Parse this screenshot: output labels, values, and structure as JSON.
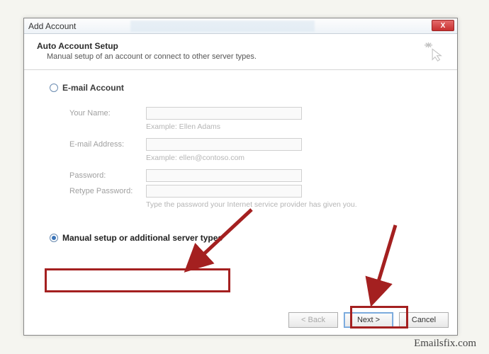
{
  "window": {
    "title": "Add Account",
    "close_label": "X"
  },
  "header": {
    "title": "Auto Account Setup",
    "subtitle": "Manual setup of an account or connect to other server types."
  },
  "options": {
    "email_account": "E-mail Account",
    "manual_setup": "Manual setup or additional server types"
  },
  "form": {
    "your_name_label": "Your Name:",
    "your_name_value": "",
    "your_name_hint": "Example: Ellen Adams",
    "email_label": "E-mail Address:",
    "email_value": "",
    "email_hint": "Example: ellen@contoso.com",
    "password_label": "Password:",
    "password_value": "",
    "retype_label": "Retype Password:",
    "retype_value": "",
    "password_hint": "Type the password your Internet service provider has given you."
  },
  "buttons": {
    "back": "< Back",
    "next": "Next >",
    "cancel": "Cancel"
  },
  "watermark": "Emailsfix.com"
}
